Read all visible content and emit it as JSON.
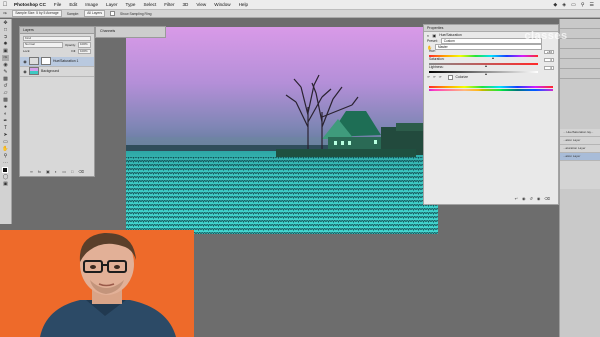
{
  "menubar": {
    "items": [
      "Photoshop CC",
      "File",
      "Edit",
      "Image",
      "Layer",
      "Type",
      "Select",
      "Filter",
      "3D",
      "View",
      "Window",
      "Help"
    ]
  },
  "options_bar": {
    "sample_size": "Sample Size: 5 by 5 Average",
    "sample": "All Layers",
    "sample_label": "Sample:",
    "show_ring": "Show Sampling Ring"
  },
  "layers_panel": {
    "title": "Layers",
    "kind": "Kind",
    "blend_mode": "Normal",
    "opacity_label": "Opacity:",
    "opacity": "100%",
    "lock_label": "Lock:",
    "fill_label": "Fill:",
    "fill": "100%",
    "layers": [
      {
        "name": "Hue/Saturation 1",
        "selected": true
      },
      {
        "name": "Background",
        "selected": false
      }
    ],
    "footer_icons": [
      "link-icon",
      "fx-icon",
      "mask-icon",
      "adjustment-icon",
      "folder-icon",
      "new-layer-icon",
      "trash-icon"
    ]
  },
  "channels_panel": {
    "title": "Channels"
  },
  "properties_panel": {
    "title": "Properties",
    "adjustment": "Hue/Saturation",
    "preset_label": "Preset:",
    "preset": "Custom",
    "channel": "Master",
    "hue_label": "Hue:",
    "hue": 0.56,
    "hue_value": "+66",
    "saturation_label": "Saturation:",
    "saturation": 0.5,
    "saturation_value": "0",
    "lightness_label": "Lightness:",
    "lightness": 0.5,
    "lightness_value": "0",
    "colorize_label": "Colorize"
  },
  "right_panel": {
    "items": [
      "... Hue/Saturation lay...",
      "...ation Layer",
      "...aturation Layer",
      "...ation Layer"
    ]
  },
  "watermark": "classes",
  "colors": {
    "sky_top": "#c78be8",
    "sky_bottom": "#6a7fa0",
    "field": "#3fd0c8",
    "video_bg": "#ef6a2b",
    "selected_layer": "#b9c9df"
  }
}
